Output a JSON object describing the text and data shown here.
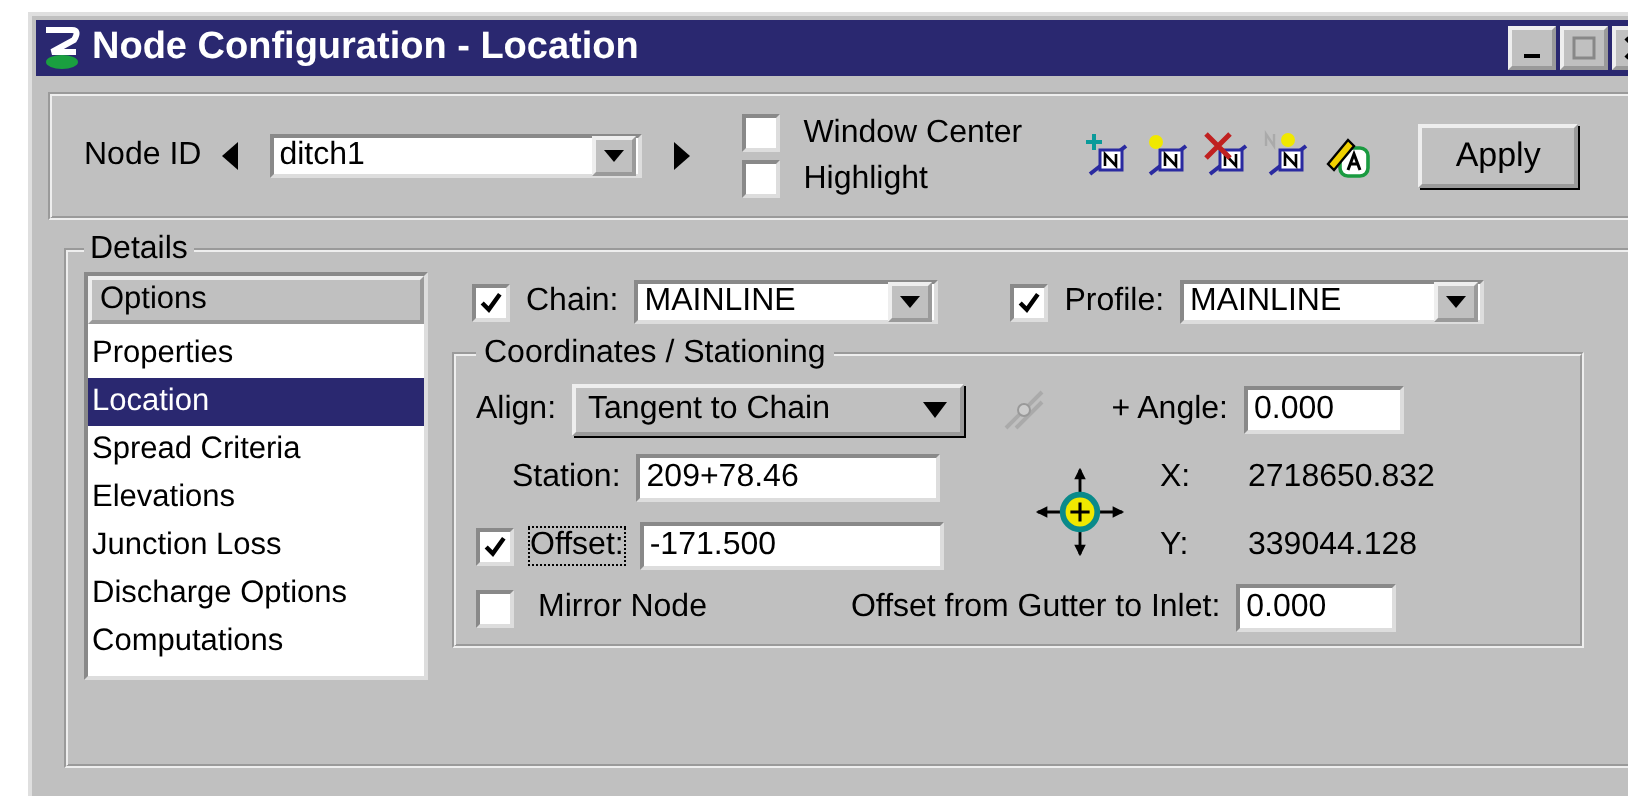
{
  "window": {
    "title": "Node Configuration - Location"
  },
  "top": {
    "node_id_label": "Node ID",
    "node_id_value": "ditch1",
    "checkboxes": [
      {
        "label": "Window Center",
        "checked": false
      },
      {
        "label": "Highlight",
        "checked": false
      }
    ],
    "apply": "Apply"
  },
  "details": {
    "title": "Details",
    "options_header": "Options",
    "options": [
      {
        "label": "Properties",
        "selected": false
      },
      {
        "label": "Location",
        "selected": true
      },
      {
        "label": "Spread Criteria",
        "selected": false
      },
      {
        "label": "Elevations",
        "selected": false
      },
      {
        "label": "Junction Loss",
        "selected": false
      },
      {
        "label": "Discharge Options",
        "selected": false
      },
      {
        "label": "Computations",
        "selected": false
      }
    ],
    "chain": {
      "label": "Chain:",
      "checked": true,
      "value": "MAINLINE"
    },
    "profile": {
      "label": "Profile:",
      "checked": true,
      "value": "MAINLINE"
    },
    "coordinates": {
      "title": "Coordinates / Stationing",
      "align_label": "Align:",
      "align_value": "Tangent to Chain",
      "angle_label": "+ Angle:",
      "angle_value": "0.000",
      "station_label": "Station:",
      "station_value": "209+78.46",
      "offset": {
        "label": "Offset:",
        "checked": true,
        "value": "-171.500"
      },
      "x_label": "X:",
      "x_value": "2718650.832",
      "y_label": "Y:",
      "y_value": "339044.128",
      "mirror": {
        "label": "Mirror Node",
        "checked": false
      },
      "gutter_label": "Offset from Gutter to Inlet:",
      "gutter_value": "0.000"
    }
  }
}
